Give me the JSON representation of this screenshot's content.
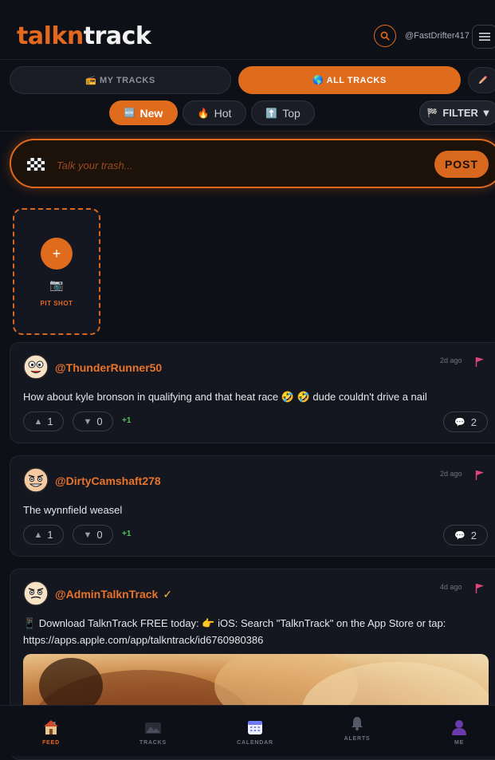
{
  "header": {
    "logo_part1": "talkn",
    "logo_part2": "track",
    "username": "@FastDrifter417",
    "icons": {
      "search": "search-icon",
      "menu": "hamburger-menu-icon"
    }
  },
  "tabs": {
    "my_tracks": "📻 MY TRACKS",
    "all_tracks": "🌎 ALL TRACKS",
    "active": "all_tracks",
    "edit_icon": "pencil-icon"
  },
  "sort": {
    "new": {
      "icon": "🆕",
      "label": "New"
    },
    "hot": {
      "icon": "🔥",
      "label": "Hot"
    },
    "top": {
      "icon": "⬆️",
      "label": "Top"
    },
    "filter": {
      "icon": "🏁",
      "label": "FILTER ▼"
    },
    "active": "new"
  },
  "composer": {
    "placeholder": "Talk your trash...",
    "post_label": "POST",
    "icon": "checkered-flag-icon"
  },
  "pit_shot": {
    "plus": "+",
    "camera": "📷",
    "label": "PIT SHOT"
  },
  "posts": [
    {
      "handle": "@ThunderRunner50",
      "verified": false,
      "time": "2d ago",
      "text": "How about kyle bronson in qualifying and that heat race 🤣 🤣  dude couldn't drive a nail",
      "upvotes": "1",
      "downvotes": "0",
      "score": "+1",
      "comments": "2"
    },
    {
      "handle": "@DirtyCamshaft278",
      "verified": false,
      "time": "2d ago",
      "text": "The wynnfield weasel",
      "upvotes": "1",
      "downvotes": "0",
      "score": "+1",
      "comments": "2"
    },
    {
      "handle": "@AdminTalknTrack",
      "verified": true,
      "verified_mark": "✓",
      "time": "4d ago",
      "text": "📱 Download TalknTrack FREE today: 👉 iOS: Search \"TalknTrack\" on the App Store or tap: https://apps.apple.com/app/talkntrack/id6760980386",
      "has_media": true
    }
  ],
  "vote_glyphs": {
    "up": "▲",
    "down": "▼",
    "comment": "💬"
  },
  "bottom_nav": [
    {
      "label": "FEED",
      "icon": "house-icon",
      "active": true
    },
    {
      "label": "TRACKS",
      "icon": "track-landscape-icon",
      "active": false
    },
    {
      "label": "CALENDAR",
      "icon": "calendar-icon",
      "active": false
    },
    {
      "label": "ALERTS",
      "icon": "bell-icon",
      "active": false
    },
    {
      "label": "ME",
      "icon": "person-icon",
      "active": false
    }
  ],
  "colors": {
    "accent": "#df6b1c",
    "background": "#0e1017",
    "card": "#141720",
    "score_green": "#4ec25a",
    "report_flag": "#e0457a"
  }
}
